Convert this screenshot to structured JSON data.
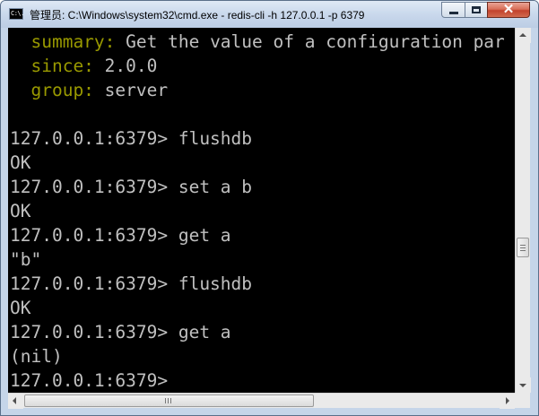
{
  "window": {
    "title": "管理员: C:\\Windows\\system32\\cmd.exe - redis-cli  -h 127.0.0.1 -p 6379",
    "icon_label": "C:\\.",
    "controls": {
      "minimize": "minimize",
      "maximize": "maximize",
      "close": "✕"
    }
  },
  "console": {
    "help": [
      {
        "key": "summary:",
        "value": " Get the value of a configuration par"
      },
      {
        "key": "since:",
        "value": " 2.0.0"
      },
      {
        "key": "group:",
        "value": " server"
      }
    ],
    "lines": [
      "127.0.0.1:6379> flushdb",
      "OK",
      "127.0.0.1:6379> set a b",
      "OK",
      "127.0.0.1:6379> get a",
      "\"b\"",
      "127.0.0.1:6379> flushdb",
      "OK",
      "127.0.0.1:6379> get a",
      "(nil)",
      "127.0.0.1:6379> "
    ]
  },
  "colors": {
    "console_background": "#000000",
    "console_text": "#c0c0c0",
    "help_key": "#999900"
  },
  "scrollbars": {
    "vertical_position": 0.62,
    "horizontal_position": 0.0
  }
}
